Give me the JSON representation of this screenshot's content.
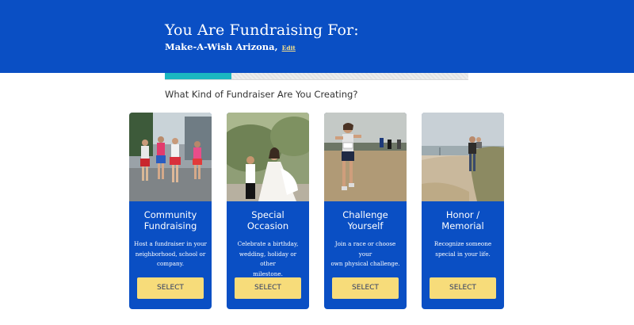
{
  "header": {
    "title": "You Are Fundraising For:",
    "organization": "Make-A-Wish Arizona,",
    "edit_label": "Edit"
  },
  "progress": {
    "fraction": 0.22,
    "fill_color": "#1bb7c1"
  },
  "question": "What Kind of Fundraiser Are You Creating?",
  "colors": {
    "brand_blue": "#0a4fc4",
    "button_yellow": "#f7dc7a"
  },
  "cards": [
    {
      "title_line1": "Community",
      "title_line2": "Fundraising",
      "desc_line1": "Host a fundraiser in your",
      "desc_line2": "neighborhood, school or",
      "desc_line3": "company.",
      "button": "SELECT",
      "photo": "runners-in-costume-photo"
    },
    {
      "title_line1": "Special",
      "title_line2": "Occasion",
      "desc_line1": "Celebrate a birthday,",
      "desc_line2": "wedding, holiday or other",
      "desc_line3": "milestone.",
      "button": "SELECT",
      "photo": "wedding-couple-photo"
    },
    {
      "title_line1": "Challenge",
      "title_line2": "Yourself",
      "desc_line1": "Join a race or choose your",
      "desc_line2": "own physical challenge.",
      "desc_line3": "",
      "button": "SELECT",
      "photo": "woman-running-race-photo"
    },
    {
      "title_line1": "Honor /",
      "title_line2": "Memorial",
      "desc_line1": "Recognize someone",
      "desc_line2": "special in your life.",
      "desc_line3": "",
      "button": "SELECT",
      "photo": "beach-walk-photo"
    }
  ]
}
